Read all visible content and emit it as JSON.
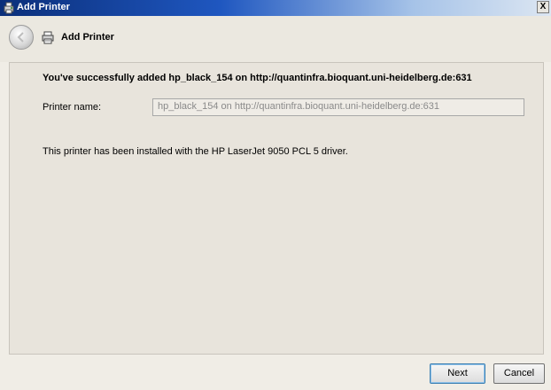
{
  "window": {
    "title": "Add Printer",
    "close_glyph": "X"
  },
  "header": {
    "title": "Add Printer",
    "back_icon": "back-arrow-icon",
    "printer_icon": "printer-icon"
  },
  "content": {
    "success_message": "You've successfully added hp_black_154 on http://quantinfra.bioquant.uni-heidelberg.de:631",
    "printer_name_label": "Printer name:",
    "printer_name_value": "hp_black_154 on http://quantinfra.bioquant.uni-heidelberg.de:631",
    "driver_message": "This printer has been installed with the HP LaserJet 9050 PCL 5 driver."
  },
  "footer": {
    "next_label": "Next",
    "cancel_label": "Cancel"
  }
}
